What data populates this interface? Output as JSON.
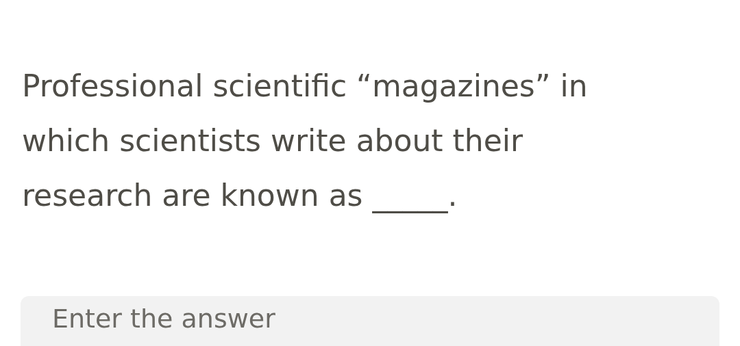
{
  "question": {
    "text": "Professional scientific “magazines” in which scientists write about their research are known as _____."
  },
  "answer": {
    "placeholder": "Enter the answer"
  }
}
